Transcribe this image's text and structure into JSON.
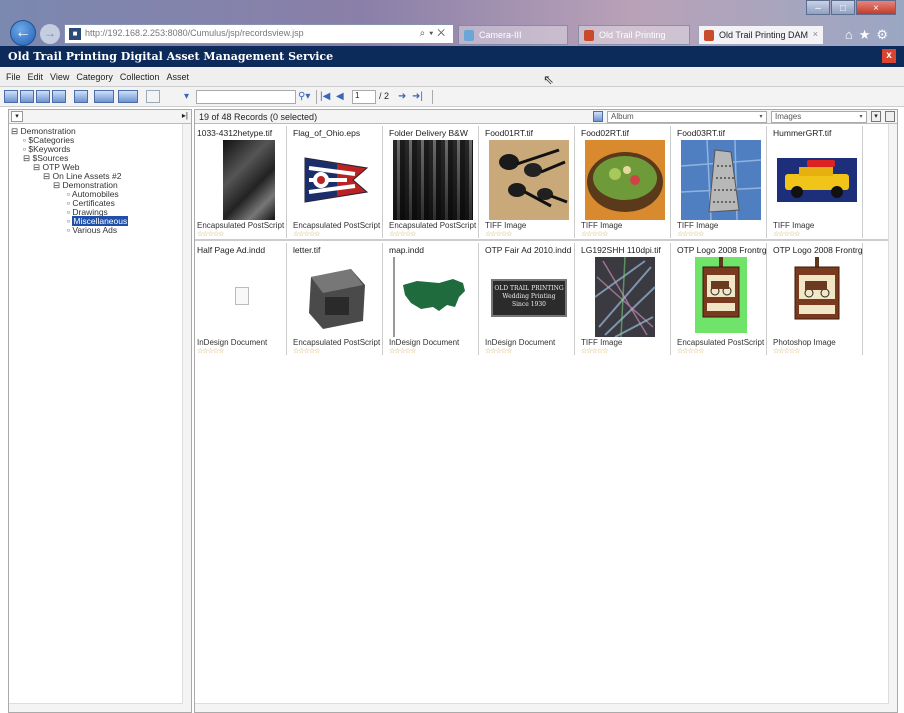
{
  "browser": {
    "address": "http://192.168.2.253:8080/Cumulus/jsp/recordsview.jsp",
    "tabs": [
      "Camera-III",
      "Old Trail Printing",
      "Old Trail Printing DAM"
    ],
    "close_tab": "×"
  },
  "app": {
    "title": "Old Trail Printing Digital Asset Management Service",
    "close": "x"
  },
  "menu": [
    "File",
    "Edit",
    "View",
    "Category",
    "Collection",
    "Asset"
  ],
  "toolbar": {
    "page_input": "1",
    "page_total": "/ 2"
  },
  "tree": [
    "Demonstration",
    "$Categories",
    "$Keywords",
    "$Sources",
    "OTP Web",
    "On Line Assets #2",
    "Demonstration",
    "Automobiles",
    "Certificates",
    "Drawings",
    "Miscellaneous",
    "Various Ads"
  ],
  "main": {
    "status": "19 of 48 Records (0 selected)",
    "sort_field": "Album",
    "view_select": "Images"
  },
  "records": [
    {
      "name": "1033-4312hetype.tif",
      "type": "Encapsulated PostScript",
      "stars": "☆☆☆☆☆",
      "thumb": "gray"
    },
    {
      "name": "Flag_of_Ohio.eps",
      "type": "Encapsulated PostScript",
      "stars": "☆☆☆☆☆",
      "thumb": "flag"
    },
    {
      "name": "Folder Delivery B&W",
      "type": "Encapsulated PostScript",
      "stars": "☆☆☆☆☆",
      "thumb": "press"
    },
    {
      "name": "Food01RT.tif",
      "type": "TIFF Image",
      "stars": "☆☆☆☆☆",
      "thumb": "spoons"
    },
    {
      "name": "Food02RT.tif",
      "type": "TIFF Image",
      "stars": "☆☆☆☆☆",
      "thumb": "salad"
    },
    {
      "name": "Food03RT.tif",
      "type": "TIFF Image",
      "stars": "☆☆☆☆☆",
      "thumb": "grater"
    },
    {
      "name": "HummerGRT.tif",
      "type": "TIFF Image",
      "stars": "☆☆☆☆☆",
      "thumb": "hummer"
    },
    {
      "name": "Half Page Ad.indd",
      "type": "InDesign Document",
      "stars": "☆☆☆☆☆",
      "thumb": "page"
    },
    {
      "name": "letter.tif",
      "type": "Encapsulated PostScript",
      "stars": "☆☆☆☆☆",
      "thumb": "letter"
    },
    {
      "name": "map.indd",
      "type": "InDesign Document",
      "stars": "☆☆☆☆☆",
      "thumb": "map"
    },
    {
      "name": "OTP Fair Ad 2010.indd",
      "type": "InDesign Document",
      "stars": "☆☆☆☆☆",
      "thumb": "ad"
    },
    {
      "name": "LG192SHH 110dpi.tif",
      "type": "TIFF Image",
      "stars": "☆☆☆☆☆",
      "thumb": "rays"
    },
    {
      "name": "OTP Logo 2008 Frontrg",
      "type": "Encapsulated PostScript",
      "stars": "☆☆☆☆☆",
      "thumb": "logo-green"
    },
    {
      "name": "OTP Logo 2008 Frontrg",
      "type": "Photoshop Image",
      "stars": "☆☆☆☆☆",
      "thumb": "logo-white"
    }
  ],
  "ad_text": [
    "OLD TRAIL PRINTING",
    "Wedding Printing",
    "Since 1930"
  ],
  "logo_text": "Old Trail"
}
